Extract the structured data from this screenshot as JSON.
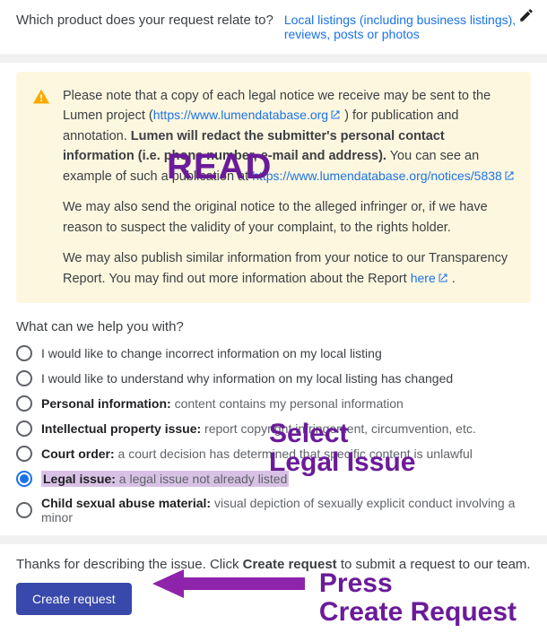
{
  "product_section": {
    "question": "Which product does your request relate to?",
    "link": "Local listings (including business listings), reviews, posts or photos"
  },
  "notice": {
    "p1_prefix": "Please note that a copy of each legal notice we receive may be sent to the Lumen project (",
    "p1_link1": "https://www.lumendatabase.org",
    "p1_mid": " ) for publication and annotation. ",
    "p1_bold": "Lumen will redact the submitter's personal contact information (i.e. phone number, e-mail and address).",
    "p1_after": " You can see an example of such a publication at ",
    "p1_link2": "https://www.lumendatabase.org/notices/5838",
    "p2": "We may also send the original notice to the alleged infringer or, if we have reason to suspect the validity of your complaint, to the rights holder.",
    "p3_prefix": "We may also publish similar information from your notice to our Transparency Report. You may find out more information about the Report ",
    "p3_link": "here",
    "p3_suffix": " ."
  },
  "help": {
    "title": "What can we help you with?",
    "options": [
      {
        "bold": "",
        "text": "I would like to change incorrect information on my local listing",
        "checked": false,
        "highlight": false
      },
      {
        "bold": "",
        "text": "I would like to understand why information on my local listing has changed",
        "checked": false,
        "highlight": false
      },
      {
        "bold": "Personal information:",
        "text": " content contains my personal information",
        "checked": false,
        "highlight": false
      },
      {
        "bold": "Intellectual property issue:",
        "text": " report copyright infringement, circumvention, etc.",
        "checked": false,
        "highlight": false
      },
      {
        "bold": "Court order:",
        "text": " a court decision has determined that specific content is unlawful",
        "checked": false,
        "highlight": false
      },
      {
        "bold": "Legal issue:",
        "text": " a legal issue not already listed",
        "checked": true,
        "highlight": true
      },
      {
        "bold": "Child sexual abuse material:",
        "text": " visual depiction of sexually explicit conduct involving a minor",
        "checked": false,
        "highlight": false
      }
    ]
  },
  "footer": {
    "thanks_pre": "Thanks for describing the issue. Click ",
    "thanks_bold": "Create request",
    "thanks_post": " to submit a request to our team.",
    "button": "Create request"
  },
  "annotations": {
    "read": "READ",
    "select1": "Select",
    "select2": "Legal Issue",
    "press1": "Press",
    "press2": "Create Request"
  }
}
